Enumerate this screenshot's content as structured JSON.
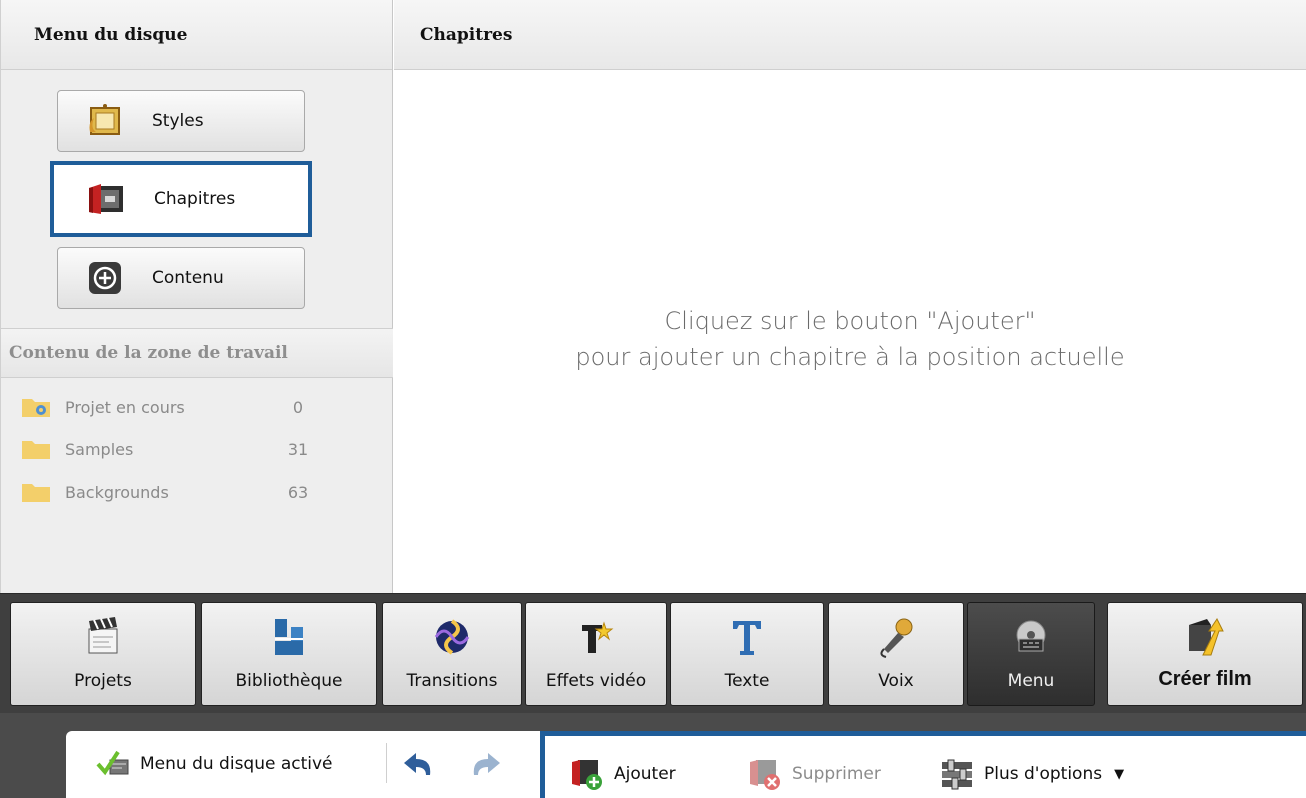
{
  "left_panel": {
    "header": "Menu du disque",
    "nav": [
      {
        "label": "Styles",
        "icon": "frame-icon"
      },
      {
        "label": "Chapitres",
        "icon": "chapter-film-icon",
        "active": true
      },
      {
        "label": "Contenu",
        "icon": "plus-circle-icon"
      }
    ],
    "zone_header": "Contenu de la zone de travail",
    "folders": [
      {
        "name": "Projet en cours",
        "count": "0",
        "icon": "project-folder-icon"
      },
      {
        "name": "Samples",
        "count": "31",
        "icon": "folder-icon"
      },
      {
        "name": "Backgrounds",
        "count": "63",
        "icon": "folder-icon"
      }
    ]
  },
  "main": {
    "header": "Chapitres",
    "hint_line1": "Cliquez sur le bouton \"Ajouter\"",
    "hint_line2": "pour ajouter un chapitre à la position actuelle"
  },
  "toolbar": {
    "buttons": [
      {
        "label": "Projets",
        "icon": "clapperboard-icon"
      },
      {
        "label": "Bibliothèque",
        "icon": "film-library-icon"
      },
      {
        "label": "Transitions",
        "icon": "transition-swirl-icon"
      },
      {
        "label": "Effets vidéo",
        "icon": "video-effects-icon"
      },
      {
        "label": "Texte",
        "icon": "text-t-icon"
      },
      {
        "label": "Voix",
        "icon": "microphone-icon"
      },
      {
        "label": "Menu",
        "icon": "disc-menu-icon",
        "active": true
      },
      {
        "label": "Créer film",
        "icon": "create-movie-icon"
      }
    ]
  },
  "status": {
    "menu_enabled": "Menu du disque activé",
    "add": "Ajouter",
    "delete": "Supprimer",
    "more": "Plus d'options",
    "dropdown_arrow": "▼"
  },
  "colors": {
    "accent": "#1f5d99",
    "toolbar_bg": "#3f3f3f",
    "panel_bg": "#eeeeee"
  }
}
